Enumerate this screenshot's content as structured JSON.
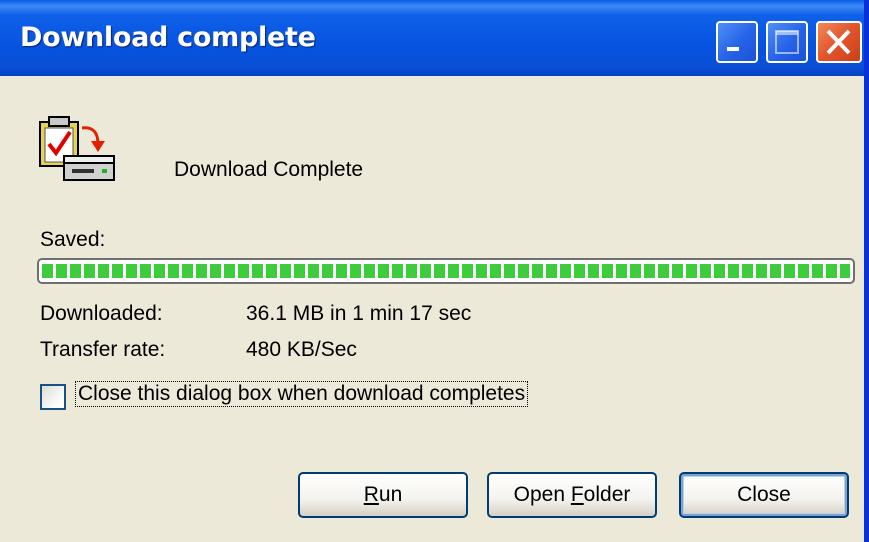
{
  "window": {
    "title": "Download complete",
    "colors": {
      "titlebar": "#0653e0",
      "face": "#ece9d8",
      "close_button": "#e2532a",
      "progress_fill": "#3ecc3e"
    },
    "controls": {
      "minimize_icon": "minimize-icon",
      "maximize_icon": "maximize-icon",
      "close_icon": "close-icon"
    }
  },
  "content": {
    "icon": "download-complete-icon",
    "heading": "Download Complete",
    "saved_label": "Saved:",
    "progress_fraction": 1.0,
    "downloaded_label": "Downloaded:",
    "downloaded_value": "36.1 MB in 1 min 17 sec",
    "rate_label": "Transfer rate:",
    "rate_value": "480 KB/Sec",
    "close_checkbox": {
      "label": "Close this dialog box when download completes",
      "checked": false
    }
  },
  "buttons": {
    "run": {
      "pre": "",
      "mnemonic": "R",
      "post": "un"
    },
    "open_folder": {
      "pre": "Open ",
      "mnemonic": "F",
      "post": "older"
    },
    "close": "Close"
  }
}
